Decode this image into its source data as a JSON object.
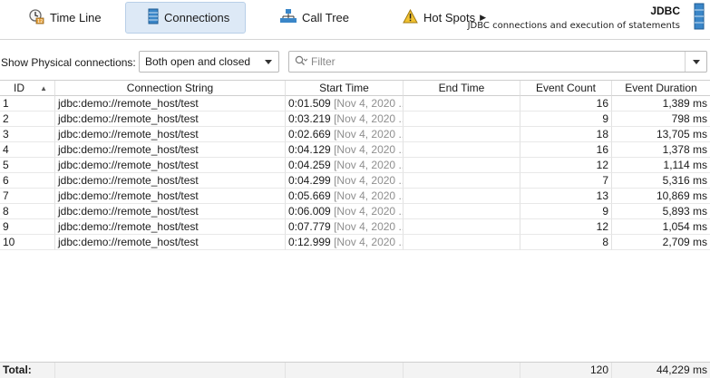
{
  "toolbar": {
    "timeline": {
      "label": "Time Line",
      "icon": "clock-icon"
    },
    "connections": {
      "label": "Connections",
      "icon": "connections-icon"
    },
    "calltree": {
      "label": "Call Tree",
      "icon": "tree-icon"
    },
    "hotspots": {
      "label": "Hot Spots",
      "icon": "warning-icon"
    },
    "jdbc": {
      "title": "JDBC",
      "subtitle": "JDBC connections and execution of statements"
    }
  },
  "filterbar": {
    "show_label": "Show Physical connections:",
    "combo_value": "Both open and closed",
    "filter_placeholder": "Filter"
  },
  "table": {
    "columns": [
      "ID",
      "Connection String",
      "Start Time",
      "End Time",
      "Event Count",
      "Event Duration"
    ],
    "rows": [
      {
        "id": "1",
        "conn": "jdbc:demo://remote_host/test",
        "start": "0:01.509",
        "start_extra": "[Nov 4, 2020 ...",
        "end": "",
        "count": "16",
        "duration": "1,389 ms"
      },
      {
        "id": "2",
        "conn": "jdbc:demo://remote_host/test",
        "start": "0:03.219",
        "start_extra": "[Nov 4, 2020 ...",
        "end": "",
        "count": "9",
        "duration": "798 ms"
      },
      {
        "id": "3",
        "conn": "jdbc:demo://remote_host/test",
        "start": "0:02.669",
        "start_extra": "[Nov 4, 2020 ...",
        "end": "",
        "count": "18",
        "duration": "13,705 ms"
      },
      {
        "id": "4",
        "conn": "jdbc:demo://remote_host/test",
        "start": "0:04.129",
        "start_extra": "[Nov 4, 2020 ...",
        "end": "",
        "count": "16",
        "duration": "1,378 ms"
      },
      {
        "id": "5",
        "conn": "jdbc:demo://remote_host/test",
        "start": "0:04.259",
        "start_extra": "[Nov 4, 2020 ...",
        "end": "",
        "count": "12",
        "duration": "1,114 ms"
      },
      {
        "id": "6",
        "conn": "jdbc:demo://remote_host/test",
        "start": "0:04.299",
        "start_extra": "[Nov 4, 2020 ...",
        "end": "",
        "count": "7",
        "duration": "5,316 ms"
      },
      {
        "id": "7",
        "conn": "jdbc:demo://remote_host/test",
        "start": "0:05.669",
        "start_extra": "[Nov 4, 2020 ...",
        "end": "",
        "count": "13",
        "duration": "10,869 ms"
      },
      {
        "id": "8",
        "conn": "jdbc:demo://remote_host/test",
        "start": "0:06.009",
        "start_extra": "[Nov 4, 2020 ...",
        "end": "",
        "count": "9",
        "duration": "5,893 ms"
      },
      {
        "id": "9",
        "conn": "jdbc:demo://remote_host/test",
        "start": "0:07.779",
        "start_extra": "[Nov 4, 2020 ...",
        "end": "",
        "count": "12",
        "duration": "1,054 ms"
      },
      {
        "id": "10",
        "conn": "jdbc:demo://remote_host/test",
        "start": "0:12.999",
        "start_extra": "[Nov 4, 2020 ...",
        "end": "",
        "count": "8",
        "duration": "2,709 ms"
      }
    ],
    "totals": {
      "label": "Total:",
      "count": "120",
      "duration": "44,229 ms"
    }
  },
  "colors": {
    "active_tab_bg": "#dde9f6",
    "active_tab_border": "#b8cfe8",
    "muted_text": "#8f8f8f"
  }
}
